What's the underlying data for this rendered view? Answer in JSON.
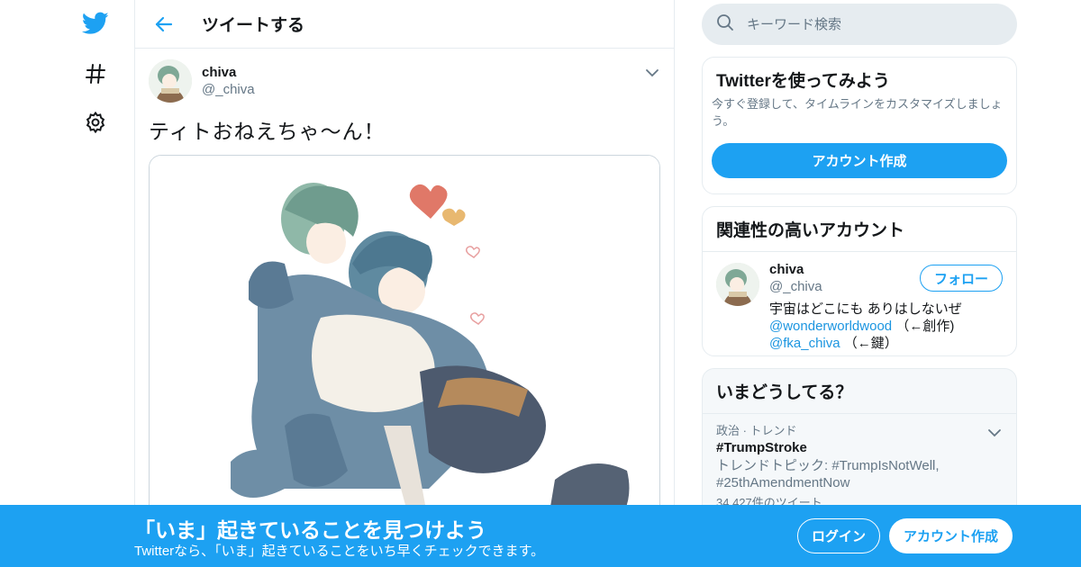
{
  "colors": {
    "accent": "#1da1f2",
    "text": "#14171a",
    "muted": "#657786",
    "border": "#e6ecf0"
  },
  "nav": {
    "icons": [
      "twitter-bird-icon",
      "hashtag-icon",
      "gear-icon"
    ]
  },
  "header": {
    "title": "ツイートする"
  },
  "tweet": {
    "name": "chiva",
    "handle": "@_chiva",
    "text": "ティトおねえちゃ〜ん！"
  },
  "search": {
    "placeholder": "キーワード検索"
  },
  "signup_card": {
    "title": "Twitterを使ってみよう",
    "description": "今すぐ登録して、タイムラインをカスタマイズしましょう。",
    "button": "アカウント作成"
  },
  "relevant": {
    "title": "関連性の高いアカウント",
    "name": "chiva",
    "handle": "@_chiva",
    "follow": "フォロー",
    "bio_line1": "宇宙はどこにも ありはしないぜ",
    "link1": "@wonderworldwood",
    "link1_suffix": "（←創作)",
    "link2": "@fka_chiva",
    "link2_suffix": "（←鍵）"
  },
  "trends": {
    "title": "いまどうしてる？",
    "category": "政治 · トレンド",
    "tag": "#TrumpStroke",
    "topic": "トレンドトピック: #TrumpIsNotWell, #25thAmendmentNow",
    "count": "34,427件のツイート"
  },
  "banner": {
    "title": "「いま」起きていることを見つけよう",
    "subtitle": "Twitterなら、「いま」起きていることをいち早くチェックできます。",
    "login": "ログイン",
    "signup": "アカウント作成"
  }
}
